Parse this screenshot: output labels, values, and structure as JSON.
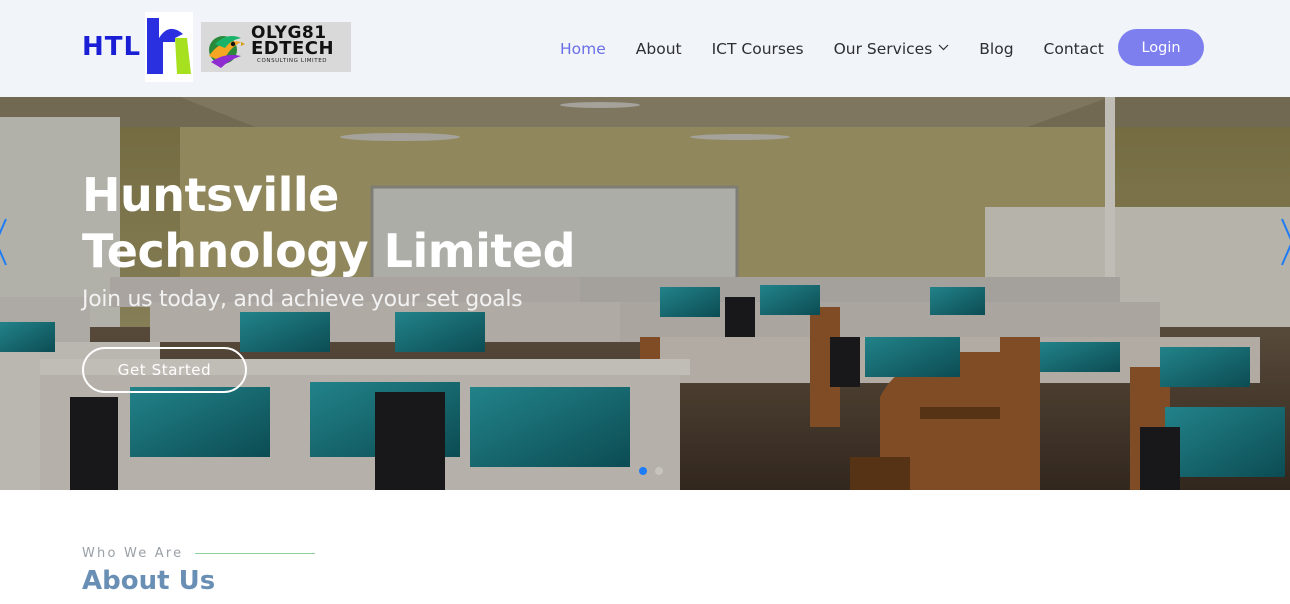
{
  "header": {
    "brand_text": "HTL",
    "partner_logo": {
      "line1": "OLYG81",
      "line2": "EDTECH",
      "line3": "CONSULTING LIMITED"
    },
    "nav": [
      {
        "label": "Home",
        "active": true
      },
      {
        "label": "About"
      },
      {
        "label": "ICT Courses"
      },
      {
        "label": "Our Services",
        "has_dropdown": true
      },
      {
        "label": "Blog"
      },
      {
        "label": "Contact"
      }
    ],
    "login_label": "Login"
  },
  "hero": {
    "title_line1": "Huntsville",
    "title_line2": "Technology Limited",
    "subtitle": "Join us today, and achieve your set goals",
    "cta_label": "Get Started",
    "slides_count": 2,
    "active_slide": 1
  },
  "about": {
    "eyebrow": "Who We Are",
    "title": "About Us"
  },
  "colors": {
    "accent": "#7d7fef",
    "nav_active": "#6a6fe5",
    "brand_blue": "#1a1fd6",
    "dot_active": "#1e7cf5",
    "eyebrow_line": "#8fd19e",
    "about_title": "#6a8fb5"
  }
}
